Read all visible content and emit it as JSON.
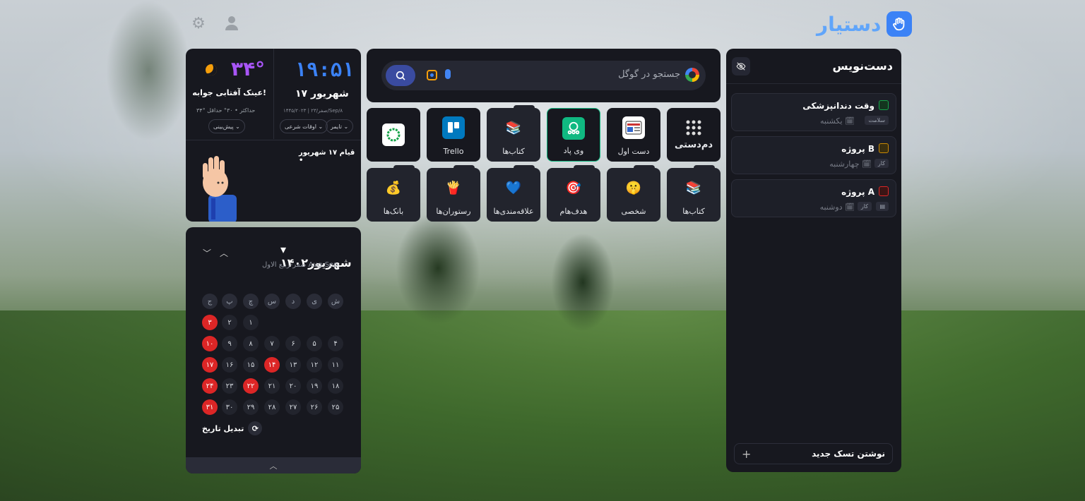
{
  "app": {
    "name": "دستیار"
  },
  "notes": {
    "title": "دست‌نویس",
    "tasks": [
      {
        "title": "وقت دندانپزشکی",
        "tag": "سلامت",
        "day": "یکشنبه",
        "color": "#16a34a"
      },
      {
        "title": "پروژه B",
        "tag": "کار",
        "day": "چهارشنبه",
        "color": "#ca8a04"
      },
      {
        "title": "پروژه A",
        "tag": "کار",
        "day": "دوشنبه",
        "color": "#dc2626"
      }
    ],
    "new_task_label": "نوشتن تسک جدید"
  },
  "search": {
    "placeholder": "جستجو در گوگل"
  },
  "shortcuts": {
    "row1": [
      {
        "label": "دم‌دستی",
        "icon": "grid-icon"
      },
      {
        "label": "دست اول",
        "icon": "news-icon"
      },
      {
        "label": "وی پاد",
        "icon": "vipod-icon"
      },
      {
        "label": "کتاب‌ها",
        "icon": "books-icon"
      },
      {
        "label": "Trello",
        "icon": "trello-icon"
      },
      {
        "label": "",
        "icon": "ring-icon"
      }
    ],
    "row2": [
      {
        "label": "کتاب‌ها",
        "icon": "books-icon"
      },
      {
        "label": "شخصی",
        "icon": "face-icon"
      },
      {
        "label": "هدف‌هام",
        "icon": "target-icon"
      },
      {
        "label": "علاقه‌مندی‌ها",
        "icon": "heart-icon"
      },
      {
        "label": "رستوران‌ها",
        "icon": "fries-icon"
      },
      {
        "label": "بانک‌ها",
        "icon": "money-bag-icon"
      }
    ]
  },
  "clock": {
    "time": "۱۹:۵۱",
    "date": "۱۷ شهریور",
    "date_sub": "۱۴۴۵/صفر/۲۳ | ۲۰۲۳/Sep/۸",
    "chips": [
      "تایمر",
      "اوقات شرعی"
    ]
  },
  "weather": {
    "temp": "۳۴°",
    "text": "عینک آفتابی جوابه!",
    "sub": "۳۴° حداکثر • ۳۰° حداقل",
    "chip": "پیش‌بینی"
  },
  "event": "قیام ۱۷ شهریور",
  "calendar": {
    "title": "شهریور۱۴۰۲",
    "sub": "صفر-ربیع الاول  Aug-Sep",
    "weekdays": [
      "ش",
      "ی",
      "د",
      "س",
      "چ",
      "پ",
      "ج"
    ],
    "rows": [
      [
        "",
        "",
        "",
        "",
        "۱",
        "۲",
        "۳"
      ],
      [
        "۴",
        "۵",
        "۶",
        "۷",
        "۸",
        "۹",
        "۱۰"
      ],
      [
        "۱۱",
        "۱۲",
        "۱۳",
        "۱۴",
        "۱۵",
        "۱۶",
        "۱۷"
      ],
      [
        "۱۸",
        "۱۹",
        "۲۰",
        "۲۱",
        "۲۲",
        "۲۳",
        "۲۴"
      ],
      [
        "۲۵",
        "۲۶",
        "۲۷",
        "۲۸",
        "۲۹",
        "۳۰",
        "۳۱"
      ]
    ],
    "holidays": [
      "۳",
      "۱۰",
      "۱۴",
      "۱۷",
      "۲۲",
      "۲۴",
      "۳۱"
    ],
    "convert_label": "تبدیل تاریخ"
  }
}
